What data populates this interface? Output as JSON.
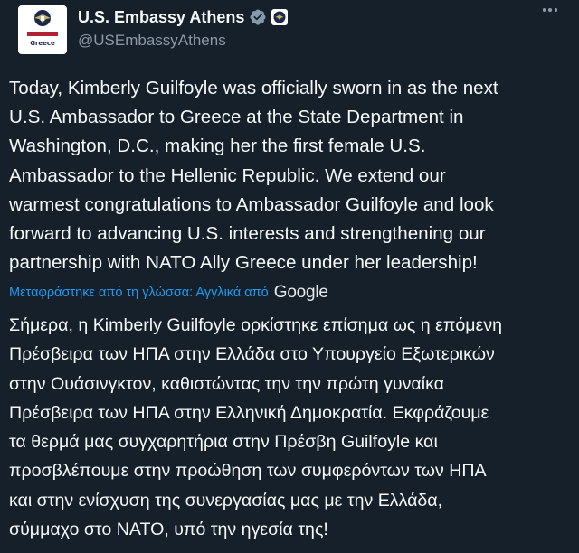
{
  "account": {
    "display_name": "U.S. Embassy Athens",
    "handle": "@USEmbassyAthens",
    "avatar_caption": "Greece",
    "verified_icon": "verified-badge-icon",
    "affiliation_icon": "government-seal-icon",
    "more_icon": "more-options-icon"
  },
  "tweet": {
    "lines": [
      "Today, Kimberly Guilfoyle was officially sworn in as the next",
      "U.S. Ambassador to Greece at the State Department in",
      "Washington, D.C., making her the first female U.S.",
      "Ambassador to the Hellenic Republic. We extend our",
      "warmest congratulations to Ambassador Guilfoyle and look",
      "forward to advancing U.S. interests and strengthening our",
      "partnership with NATO Ally Greece under her leadership!"
    ]
  },
  "translation": {
    "label": "Μεταφράστηκε από τη γλώσσα: Αγγλικά από",
    "provider": "Google",
    "lines": [
      "Σήμερα, η Kimberly Guilfoyle ορκίστηκε επίσημα ως η επόμενη",
      "Πρέσβειρα των ΗΠΑ στην Ελλάδα στο Υπουργείο Εξωτερικών",
      "στην Ουάσινγκτον, καθιστώντας την την πρώτη γυναίκα",
      "Πρέσβειρα των ΗΠΑ στην Ελληνική Δημοκρατία. Εκφράζουμε",
      "τα θερμά μας συγχαρητήρια στην Πρέσβη Guilfoyle και",
      "προσβλέπουμε στην προώθηση των συμφερόντων των ΗΠΑ",
      "και στην ενίσχυση της συνεργασίας μας με την Ελλάδα,",
      "σύμμαχο στο ΝΑΤΟ, υπό την ηγεσία της!"
    ]
  },
  "colors": {
    "background": "#15202b",
    "text": "#f7f9f9",
    "secondary": "#8b98a5",
    "link": "#1d9bf0",
    "verified": "#829aab"
  }
}
